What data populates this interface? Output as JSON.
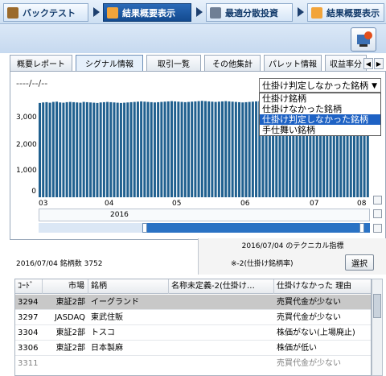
{
  "toolbar": {
    "tabs": [
      {
        "label": "バックテスト",
        "active": false
      },
      {
        "label": "結果概要表示",
        "active": true
      },
      {
        "label": "最適分散投資",
        "active": false
      },
      {
        "label": "結果概要表示",
        "active": false
      }
    ]
  },
  "subtabs": {
    "items": [
      "概要レポート",
      "シグナル情報",
      "取引一覧",
      "その他集計",
      "パレット情報",
      "収益率分"
    ],
    "active_index": 1,
    "nav_left": "◀",
    "nav_right": "▶"
  },
  "chart": {
    "date_label": "----/--/--",
    "dropdown_value": "仕掛け判定しなかった銘柄",
    "dropdown_options": [
      "仕掛け銘柄",
      "仕掛けなかった銘柄",
      "仕掛け判定しなかった銘柄",
      "手仕舞い銘柄"
    ],
    "selected_option_index": 2
  },
  "chart_data": {
    "type": "bar",
    "y_ticks": [
      "0",
      "1,000",
      "2,000",
      "3,000"
    ],
    "x_ticks": [
      "03",
      "04",
      "05",
      "06",
      "07",
      "08"
    ],
    "year_label": "2016",
    "ylim": [
      0,
      3800
    ],
    "values": [
      3560,
      3580,
      3590,
      3570,
      3600,
      3610,
      3580,
      3570,
      3590,
      3600,
      3590,
      3580,
      3570,
      3600,
      3590,
      3580,
      3570,
      3560,
      3580,
      3590,
      3600,
      3590,
      3580,
      3570,
      3560,
      3570,
      3580,
      3590,
      3600,
      3610,
      3620,
      3610,
      3600,
      3590,
      3580,
      3590,
      3600,
      3610,
      3620,
      3630,
      3620,
      3610,
      3600,
      3590,
      3600,
      3610,
      3620,
      3630,
      3640,
      3630,
      3620,
      3610,
      3600,
      3610,
      3620,
      3630,
      3620,
      3610,
      3600,
      3590,
      3580,
      3590,
      3600,
      3610,
      3620,
      3630,
      3620,
      3610,
      3600,
      3610,
      3620,
      3630,
      3640,
      3630,
      3620,
      3610,
      3600,
      3590,
      3600,
      3610,
      3620,
      3610,
      3600,
      3590,
      3580,
      3590,
      3600,
      3610,
      3620,
      3610,
      3600,
      3590,
      3580,
      3570,
      3580,
      3590,
      3600,
      3610
    ]
  },
  "info": {
    "date_count": "2016/07/04  銘柄数 3752",
    "tech_title": "2016/07/04 のテクニカル指標",
    "tech_name": "※-2(仕掛け銘柄率)",
    "select_button": "選択"
  },
  "table": {
    "headers": [
      "ｺｰﾄﾞ",
      "市場",
      "銘柄",
      "名称未定義-2(仕掛け…",
      "仕掛けなかった 理由"
    ],
    "rows": [
      [
        "3294",
        "東証2部",
        "イーグランド",
        "",
        "売買代金が少ない"
      ],
      [
        "3297",
        "JASDAQ",
        "東武住販",
        "",
        "売買代金が少ない"
      ],
      [
        "3304",
        "東証2部",
        "トスコ",
        "",
        "株価がない(上場廃止)"
      ],
      [
        "3306",
        "東証2部",
        "日本製麻",
        "",
        "株価が低い"
      ],
      [
        "3311",
        "",
        "",
        "",
        "売買代金が少ない"
      ]
    ],
    "selected_row": 0
  }
}
